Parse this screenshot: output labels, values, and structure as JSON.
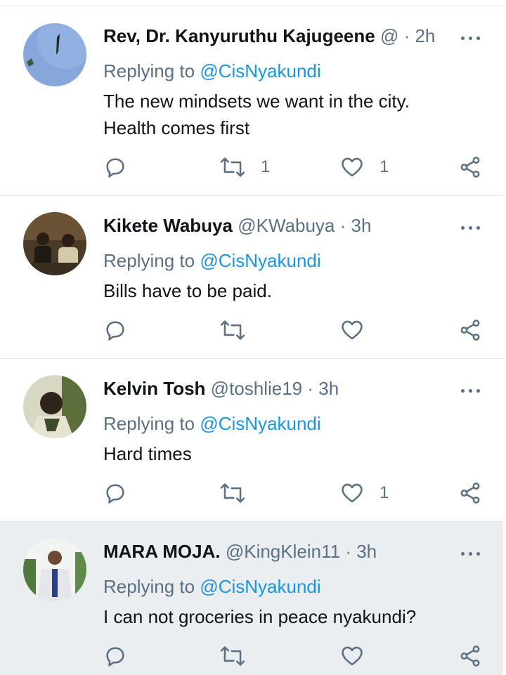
{
  "tweets": [
    {
      "name": "Rev, Dr. Kanyuruthu Kajugeene",
      "handle": "@",
      "time": "· 2h",
      "reply_prefix": "Replying to",
      "mention": "@CisNyakundi",
      "text_lines": [
        "The new mindsets we want in the city.",
        "Health comes first"
      ],
      "retweets": "1",
      "likes": "1",
      "avatar_colors": [
        "#7f9fd6",
        "#2f4f3f"
      ],
      "highlighted": false
    },
    {
      "name": "Kikete Wabuya",
      "handle": "@KWabuya",
      "time": "· 3h",
      "reply_prefix": "Replying to",
      "mention": "@CisNyakundi",
      "text_lines": [
        "Bills have to be paid."
      ],
      "retweets": "",
      "likes": "",
      "avatar_colors": [
        "#5a4530",
        "#c8a070"
      ],
      "highlighted": false
    },
    {
      "name": "Kelvin Tosh",
      "handle": "@toshlie19",
      "time": "· 3h",
      "reply_prefix": "Replying to",
      "mention": "@CisNyakundi",
      "text_lines": [
        "Hard times"
      ],
      "retweets": "",
      "likes": "1",
      "avatar_colors": [
        "#d9d9c8",
        "#3a2f25"
      ],
      "highlighted": false
    },
    {
      "name": "MARA MOJA.",
      "handle": "@KingKlein11",
      "time": "· 3h",
      "reply_prefix": "Replying to",
      "mention": "@CisNyakundi",
      "text_lines": [
        "I can not groceries in peace nyakundi?"
      ],
      "retweets": "",
      "likes": "",
      "avatar_colors": [
        "#e8ecef",
        "#2a3f7a"
      ],
      "highlighted": true
    }
  ],
  "colors": {
    "name": "#0f1419",
    "secondary": "#5b7083",
    "mention": "#1b95e0",
    "divider": "#e1e8ed",
    "highlight_bg": "#ebeef0"
  },
  "icons": {
    "reply": "reply-icon",
    "retweet": "retweet-icon",
    "like": "heart-icon",
    "share": "share-icon",
    "more": "more-icon"
  }
}
